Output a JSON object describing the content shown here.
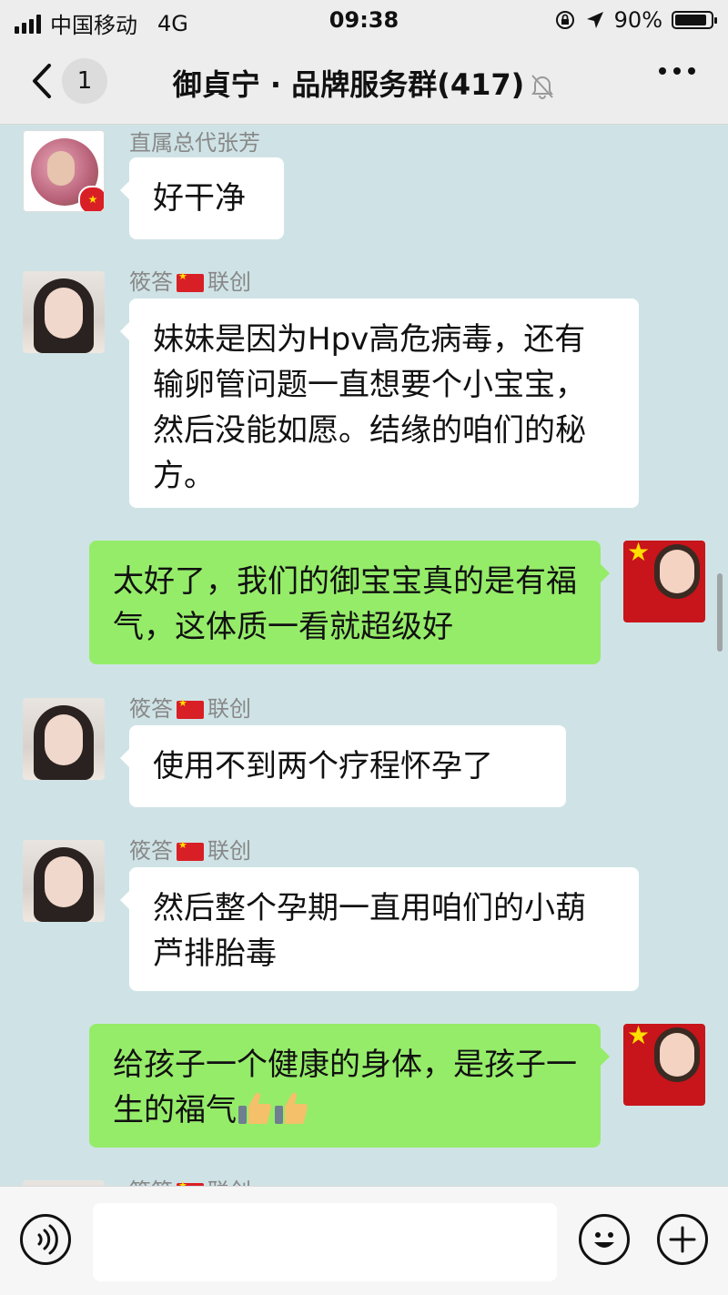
{
  "status": {
    "carrier": "中国移动",
    "network": "4G",
    "time": "09:38",
    "battery_percent": "90%",
    "battery_level": 0.9
  },
  "nav": {
    "unread_count": "1",
    "title": "御貞宁 · 品牌服务群(417)"
  },
  "messages": [
    {
      "sender": "直属总代张芳",
      "text": "好干净",
      "side": "in"
    },
    {
      "sender_name": "筱答",
      "sender_suffix": "联创",
      "text": "妹妹是因为Hpv高危病毒，还有输卵管问题一直想要个小宝宝，然后没能如愿。结缘的咱们的秘方。",
      "side": "in"
    },
    {
      "text": "太好了，我们的御宝宝真的是有福气，这体质一看就超级好",
      "side": "out"
    },
    {
      "sender_name": "筱答",
      "sender_suffix": "联创",
      "text": "使用不到两个疗程怀孕了",
      "side": "in"
    },
    {
      "sender_name": "筱答",
      "sender_suffix": "联创",
      "text": "然后整个孕期一直用咱们的小葫芦排胎毒",
      "side": "in"
    },
    {
      "text": "给孩子一个健康的身体，是孩子一生的福气",
      "side": "out"
    },
    {
      "sender_name": "筱答",
      "sender_suffix": "联创",
      "side": "in"
    }
  ],
  "icons": {
    "back": "chevron-left-icon",
    "mute": "bell-off-icon",
    "more": "more-icon",
    "voice": "voice-icon",
    "emoji": "emoji-icon",
    "plus": "plus-icon",
    "thumbs_up": "thumbs-up-icon"
  },
  "colors": {
    "bar_bg": "#ededed",
    "chat_bg": "#cfe3e6",
    "incoming_bubble": "#ffffff",
    "outgoing_bubble": "#95ec69"
  }
}
